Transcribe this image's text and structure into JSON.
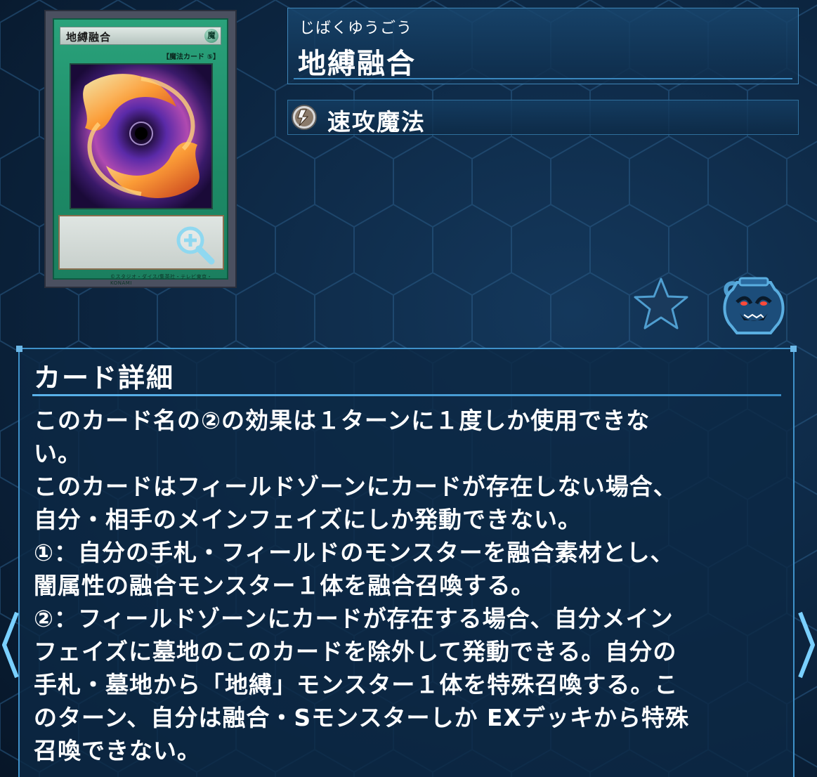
{
  "card": {
    "ruby": "じばくゆうごう",
    "name": "地縛融合",
    "type": "速攻魔法",
    "image": {
      "name": "地縛融合",
      "attribute": "魔",
      "type_line": "【魔法カード ⑤】",
      "footer": "©スタジオ・ダイス/集英社・テレビ東京・KONAMI"
    }
  },
  "icons": {
    "type_icon": "quick-play-spell-icon",
    "zoom": "zoom-in-icon",
    "favorite": "star-icon",
    "pot": "pot-of-greed-icon",
    "prev": "chevron-left-icon",
    "next": "chevron-right-icon"
  },
  "detail": {
    "heading": "カード詳細",
    "lines": [
      "このカード名の②の効果は１ターンに１度しか使用できな",
      "い。",
      "このカードはフィールドゾーンにカードが存在しない場合、",
      "自分・相手のメインフェイズにしか発動できない。",
      "①：自分の手札・フィールドのモンスターを融合素材とし、",
      "闇属性の融合モンスター１体を融合召喚する。",
      "②：フィールドゾーンにカードが存在する場合、自分メイン",
      "フェイズに墓地のこのカードを除外して発動できる。自分の",
      "手札・墓地から「地縛」モンスター１体を特殊召喚する。こ",
      "のターン、自分は融合・Sモンスターしか EXデッキから特殊",
      "召喚できない。"
    ]
  },
  "colors": {
    "background": "#0b2138",
    "panel_border": "#3f91c9",
    "spell_green": "#1d8a66",
    "text": "#ffffff"
  }
}
